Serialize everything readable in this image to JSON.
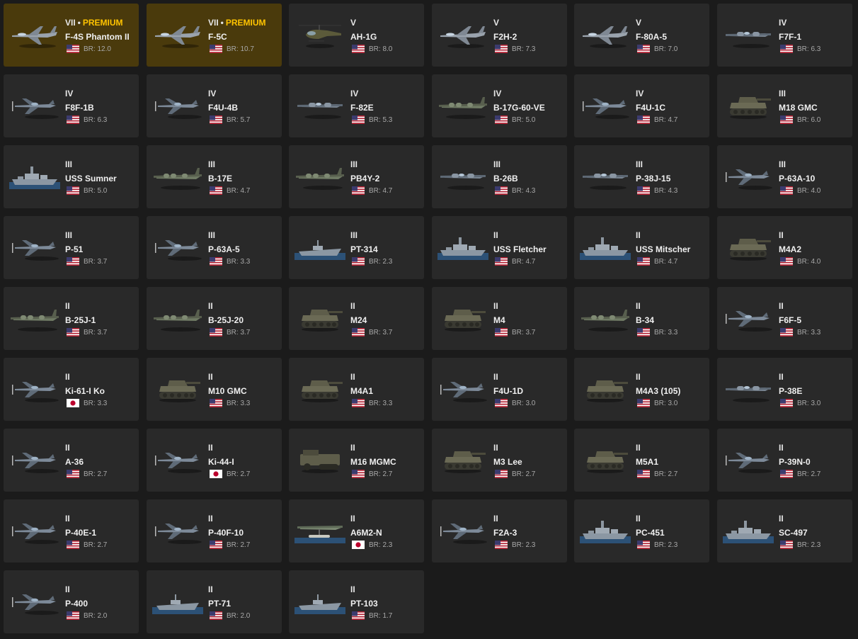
{
  "br_label": "BR:",
  "premium_label": "PREMIUM",
  "colors": {
    "card": "#292929",
    "premium_card": "#4a3a0c",
    "premium_text": "#ffc400",
    "background": "#1b1b1b"
  },
  "vehicles": [
    {
      "rank": "VII",
      "premium": true,
      "name": "F-4S Phantom II",
      "nation": "usa",
      "br": "12.0",
      "type": "jet"
    },
    {
      "rank": "VII",
      "premium": true,
      "name": "F-5C",
      "nation": "usa",
      "br": "10.7",
      "type": "jet"
    },
    {
      "rank": "V",
      "premium": false,
      "name": "AH-1G",
      "nation": "usa",
      "br": "8.0",
      "type": "heli"
    },
    {
      "rank": "V",
      "premium": false,
      "name": "F2H-2",
      "nation": "usa",
      "br": "7.3",
      "type": "jet"
    },
    {
      "rank": "V",
      "premium": false,
      "name": "F-80A-5",
      "nation": "usa",
      "br": "7.0",
      "type": "jet"
    },
    {
      "rank": "IV",
      "premium": false,
      "name": "F7F-1",
      "nation": "usa",
      "br": "6.3",
      "type": "twin"
    },
    {
      "rank": "IV",
      "premium": false,
      "name": "F8F-1B",
      "nation": "usa",
      "br": "6.3",
      "type": "prop"
    },
    {
      "rank": "IV",
      "premium": false,
      "name": "F4U-4B",
      "nation": "usa",
      "br": "5.7",
      "type": "prop"
    },
    {
      "rank": "IV",
      "premium": false,
      "name": "F-82E",
      "nation": "usa",
      "br": "5.3",
      "type": "twin"
    },
    {
      "rank": "IV",
      "premium": false,
      "name": "B-17G-60-VE",
      "nation": "usa",
      "br": "5.0",
      "type": "bomber"
    },
    {
      "rank": "IV",
      "premium": false,
      "name": "F4U-1C",
      "nation": "usa",
      "br": "4.7",
      "type": "prop"
    },
    {
      "rank": "III",
      "premium": false,
      "name": "M18 GMC",
      "nation": "usa",
      "br": "6.0",
      "type": "tank"
    },
    {
      "rank": "III",
      "premium": false,
      "name": "USS Sumner",
      "nation": "usa",
      "br": "5.0",
      "type": "ship"
    },
    {
      "rank": "III",
      "premium": false,
      "name": "B-17E",
      "nation": "usa",
      "br": "4.7",
      "type": "bomber"
    },
    {
      "rank": "III",
      "premium": false,
      "name": "PB4Y-2",
      "nation": "usa",
      "br": "4.7",
      "type": "bomber"
    },
    {
      "rank": "III",
      "premium": false,
      "name": "B-26B",
      "nation": "usa",
      "br": "4.3",
      "type": "twin"
    },
    {
      "rank": "III",
      "premium": false,
      "name": "P-38J-15",
      "nation": "usa",
      "br": "4.3",
      "type": "twin"
    },
    {
      "rank": "III",
      "premium": false,
      "name": "P-63A-10",
      "nation": "usa",
      "br": "4.0",
      "type": "prop"
    },
    {
      "rank": "III",
      "premium": false,
      "name": "P-51",
      "nation": "usa",
      "br": "3.7",
      "type": "prop"
    },
    {
      "rank": "III",
      "premium": false,
      "name": "P-63A-5",
      "nation": "usa",
      "br": "3.3",
      "type": "prop"
    },
    {
      "rank": "III",
      "premium": false,
      "name": "PT-314",
      "nation": "usa",
      "br": "2.3",
      "type": "boat"
    },
    {
      "rank": "II",
      "premium": false,
      "name": "USS Fletcher",
      "nation": "usa",
      "br": "4.7",
      "type": "ship"
    },
    {
      "rank": "II",
      "premium": false,
      "name": "USS Mitscher",
      "nation": "usa",
      "br": "4.7",
      "type": "ship"
    },
    {
      "rank": "II",
      "premium": false,
      "name": "M4A2",
      "nation": "usa",
      "br": "4.0",
      "type": "tank"
    },
    {
      "rank": "II",
      "premium": false,
      "name": "B-25J-1",
      "nation": "usa",
      "br": "3.7",
      "type": "bomber"
    },
    {
      "rank": "II",
      "premium": false,
      "name": "B-25J-20",
      "nation": "usa",
      "br": "3.7",
      "type": "bomber"
    },
    {
      "rank": "II",
      "premium": false,
      "name": "M24",
      "nation": "usa",
      "br": "3.7",
      "type": "tank"
    },
    {
      "rank": "II",
      "premium": false,
      "name": "M4",
      "nation": "usa",
      "br": "3.7",
      "type": "tank"
    },
    {
      "rank": "II",
      "premium": false,
      "name": "B-34",
      "nation": "usa",
      "br": "3.3",
      "type": "bomber"
    },
    {
      "rank": "II",
      "premium": false,
      "name": "F6F-5",
      "nation": "usa",
      "br": "3.3",
      "type": "prop"
    },
    {
      "rank": "II",
      "premium": false,
      "name": "Ki-61-I Ko",
      "nation": "japan",
      "br": "3.3",
      "type": "prop"
    },
    {
      "rank": "II",
      "premium": false,
      "name": "M10 GMC",
      "nation": "usa",
      "br": "3.3",
      "type": "tank"
    },
    {
      "rank": "II",
      "premium": false,
      "name": "M4A1",
      "nation": "usa",
      "br": "3.3",
      "type": "tank"
    },
    {
      "rank": "II",
      "premium": false,
      "name": "F4U-1D",
      "nation": "usa",
      "br": "3.0",
      "type": "prop"
    },
    {
      "rank": "II",
      "premium": false,
      "name": "M4A3 (105)",
      "nation": "usa",
      "br": "3.0",
      "type": "tank"
    },
    {
      "rank": "II",
      "premium": false,
      "name": "P-38E",
      "nation": "usa",
      "br": "3.0",
      "type": "twin"
    },
    {
      "rank": "II",
      "premium": false,
      "name": "A-36",
      "nation": "usa",
      "br": "2.7",
      "type": "prop"
    },
    {
      "rank": "II",
      "premium": false,
      "name": "Ki-44-I",
      "nation": "japan",
      "br": "2.7",
      "type": "prop"
    },
    {
      "rank": "II",
      "premium": false,
      "name": "M16 MGMC",
      "nation": "usa",
      "br": "2.7",
      "type": "halftrack"
    },
    {
      "rank": "II",
      "premium": false,
      "name": "M3 Lee",
      "nation": "usa",
      "br": "2.7",
      "type": "tank"
    },
    {
      "rank": "II",
      "premium": false,
      "name": "M5A1",
      "nation": "usa",
      "br": "2.7",
      "type": "tank"
    },
    {
      "rank": "II",
      "premium": false,
      "name": "P-39N-0",
      "nation": "usa",
      "br": "2.7",
      "type": "prop"
    },
    {
      "rank": "II",
      "premium": false,
      "name": "P-40E-1",
      "nation": "usa",
      "br": "2.7",
      "type": "prop"
    },
    {
      "rank": "II",
      "premium": false,
      "name": "P-40F-10",
      "nation": "usa",
      "br": "2.7",
      "type": "prop"
    },
    {
      "rank": "II",
      "premium": false,
      "name": "A6M2-N",
      "nation": "japan",
      "br": "2.3",
      "type": "floatplane"
    },
    {
      "rank": "II",
      "premium": false,
      "name": "F2A-3",
      "nation": "usa",
      "br": "2.3",
      "type": "prop"
    },
    {
      "rank": "II",
      "premium": false,
      "name": "PC-451",
      "nation": "usa",
      "br": "2.3",
      "type": "ship"
    },
    {
      "rank": "II",
      "premium": false,
      "name": "SC-497",
      "nation": "usa",
      "br": "2.3",
      "type": "ship"
    },
    {
      "rank": "II",
      "premium": false,
      "name": "P-400",
      "nation": "usa",
      "br": "2.0",
      "type": "prop"
    },
    {
      "rank": "II",
      "premium": false,
      "name": "PT-71",
      "nation": "usa",
      "br": "2.0",
      "type": "boat"
    },
    {
      "rank": "II",
      "premium": false,
      "name": "PT-103",
      "nation": "usa",
      "br": "1.7",
      "type": "boat"
    }
  ]
}
